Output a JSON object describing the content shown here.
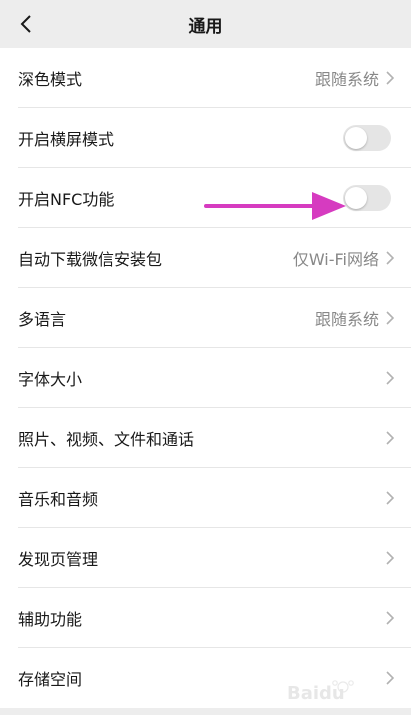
{
  "header": {
    "title": "通用",
    "back_icon": "chevron-left-icon"
  },
  "settings": {
    "dark_mode": {
      "label": "深色模式",
      "value": "跟随系统"
    },
    "landscape": {
      "label": "开启横屏模式",
      "enabled": false
    },
    "nfc": {
      "label": "开启NFC功能",
      "enabled": false
    },
    "auto_download": {
      "label": "自动下载微信安装包",
      "value": "仅Wi-Fi网络"
    },
    "language": {
      "label": "多语言",
      "value": "跟随系统"
    },
    "font_size": {
      "label": "字体大小"
    },
    "media": {
      "label": "照片、视频、文件和通话"
    },
    "music": {
      "label": "音乐和音频"
    },
    "discover": {
      "label": "发现页管理"
    },
    "accessibility": {
      "label": "辅助功能"
    },
    "storage": {
      "label": "存储空间"
    }
  },
  "annotation": {
    "arrow_color": "#d63bc0",
    "points_to": "nfc-toggle"
  },
  "colors": {
    "background": "#ededed",
    "toggle_off": "#e5e5e5",
    "secondary_text": "#888888"
  },
  "watermark": {
    "text": "Baidu"
  }
}
